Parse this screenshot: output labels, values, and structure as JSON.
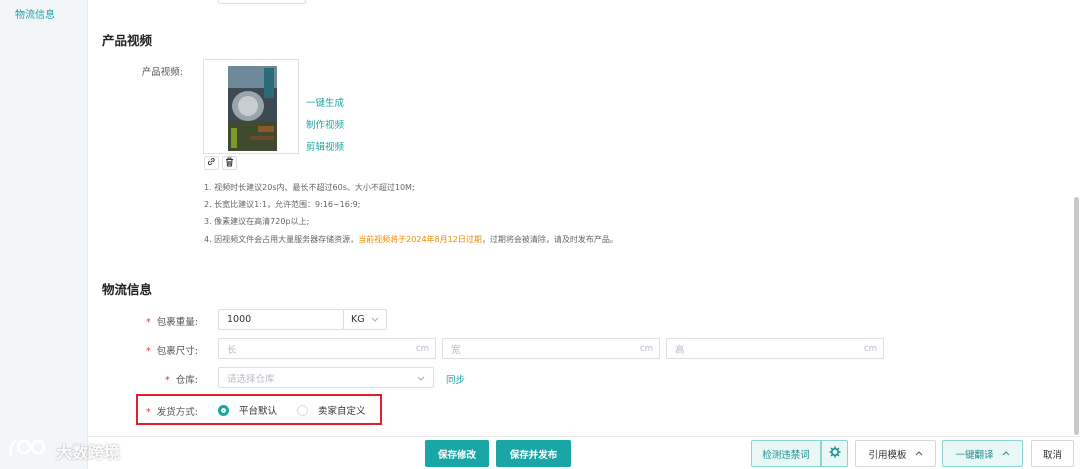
{
  "sidebar": {
    "items": [
      {
        "label": "物流信息"
      }
    ]
  },
  "video_section": {
    "title": "产品视频",
    "field_label": "产品视频:",
    "links": {
      "generate": "一键生成",
      "make": "制作视频",
      "edit": "剪辑视频"
    },
    "tips": {
      "t1": "1. 视频时长建议20s内、最长不超过60s、大小不超过10M;",
      "t2": "2. 长宽比建议1:1，允许范围：9:16~16:9;",
      "t3": "3. 像素建议在高清720p以上;",
      "t4_pre": "4. 因视频文件会占用大量服务器存储资源，",
      "t4_warn": "当前视频将于2024年8月12日过期",
      "t4_post": "，过期将会被清除，请及时发布产品。"
    }
  },
  "logistics": {
    "title": "物流信息",
    "weight": {
      "label": "包裹重量:",
      "value": "1000",
      "unit": "KG"
    },
    "size": {
      "label": "包裹尺寸:",
      "length_placeholder": "长",
      "width_placeholder": "宽",
      "height_placeholder": "高",
      "unit": "cm"
    },
    "warehouse": {
      "label": "仓库:",
      "placeholder": "请选择仓库",
      "sync_label": "同步"
    },
    "shipping": {
      "label": "发货方式:",
      "options": [
        {
          "label": "平台默认",
          "selected": true
        },
        {
          "label": "卖家自定义",
          "selected": false
        }
      ]
    }
  },
  "footer": {
    "save_label": "保存修改",
    "save_publish_label": "保存并发布",
    "check_words_label": "检测违禁词",
    "template_label": "引用模板",
    "translate_label": "一键翻译",
    "cancel_label": "取消"
  },
  "watermark": {
    "text": "大数跨境"
  },
  "colors": {
    "accent": "#1aa6a6",
    "warning": "#f08a00",
    "required": "#e03434",
    "highlight": "#e0202a"
  }
}
